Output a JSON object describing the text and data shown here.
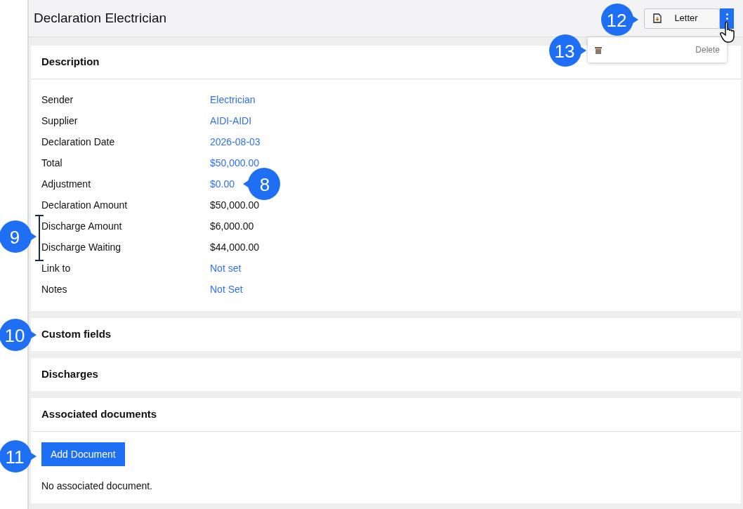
{
  "header": {
    "title": "Declaration Electrician",
    "letter_button": "Letter"
  },
  "menu": {
    "items": [
      {
        "label": "Delete"
      }
    ]
  },
  "description": {
    "title": "Description",
    "rows": [
      {
        "label": "Sender",
        "value": "Electrician",
        "link": true
      },
      {
        "label": "Supplier",
        "value": "AIDI-AIDI",
        "link": true
      },
      {
        "label": "Declaration Date",
        "value": "2026-08-03",
        "link": true
      },
      {
        "label": "Total",
        "value": "$50,000.00",
        "link": true
      },
      {
        "label": "Adjustment",
        "value": "$0.00",
        "link": true
      },
      {
        "label": "Declaration Amount",
        "value": "$50,000.00",
        "link": false
      },
      {
        "label": "Discharge Amount",
        "value": "$6,000.00",
        "link": false
      },
      {
        "label": "Discharge Waiting",
        "value": "$44,000.00",
        "link": false
      },
      {
        "label": "Link to",
        "value": "Not set",
        "link": true
      },
      {
        "label": "Notes",
        "value": "Not Set",
        "link": true
      }
    ]
  },
  "sections": [
    {
      "title": "Custom fields"
    },
    {
      "title": "Discharges"
    }
  ],
  "documents": {
    "title": "Associated documents",
    "button": "Add Document",
    "empty_text": "No associated document."
  },
  "callouts": [
    {
      "number": "12",
      "kind": "right"
    },
    {
      "number": "13",
      "kind": "right"
    },
    {
      "number": "8",
      "kind": "left"
    },
    {
      "number": "9",
      "kind": "right"
    },
    {
      "number": "10",
      "kind": "right"
    },
    {
      "number": "11",
      "kind": "right"
    }
  ]
}
